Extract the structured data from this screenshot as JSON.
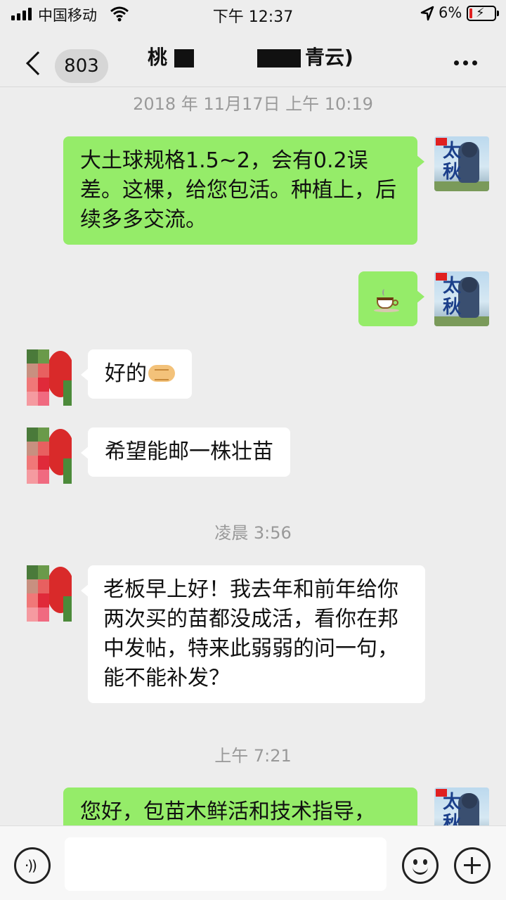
{
  "status_bar": {
    "carrier": "中国移动",
    "time": "下午 12:37",
    "battery_percent": "6%"
  },
  "nav": {
    "unread_count": "803",
    "title_left": "桃",
    "title_right": "青云)",
    "more_icon": "more-dots-icon"
  },
  "messages": [
    {
      "type": "timestamp",
      "text": "2018 年 11月17日 上午 10:19"
    },
    {
      "type": "outgoing",
      "text": "大土球规格1.5~2，会有0.2误差。这棵，给您包活。种植上，后续多多交流。"
    },
    {
      "type": "outgoing",
      "emoji": "coffee-cup-icon"
    },
    {
      "type": "incoming",
      "text": "好的",
      "emoji": "handshake-icon"
    },
    {
      "type": "incoming",
      "text": "希望能邮一株壮苗"
    },
    {
      "type": "timestamp",
      "text": "凌晨 3:56"
    },
    {
      "type": "incoming",
      "text": "老板早上好！我去年和前年给你两次买的苗都没成活，看你在邦中发帖，特来此弱弱的问一句，能不能补发？"
    },
    {
      "type": "timestamp",
      "text": "上午 7:21"
    },
    {
      "type": "outgoing",
      "text": "您好，包苗木鲜活和技术指导，"
    }
  ],
  "input_bar": {
    "voice_icon": "voice-icon",
    "emoji_icon": "emoji-icon",
    "plus_icon": "plus-icon"
  },
  "colors": {
    "background": "#ededed",
    "outgoing_bubble": "#95ec69",
    "incoming_bubble": "#ffffff",
    "timestamp": "#999999"
  }
}
